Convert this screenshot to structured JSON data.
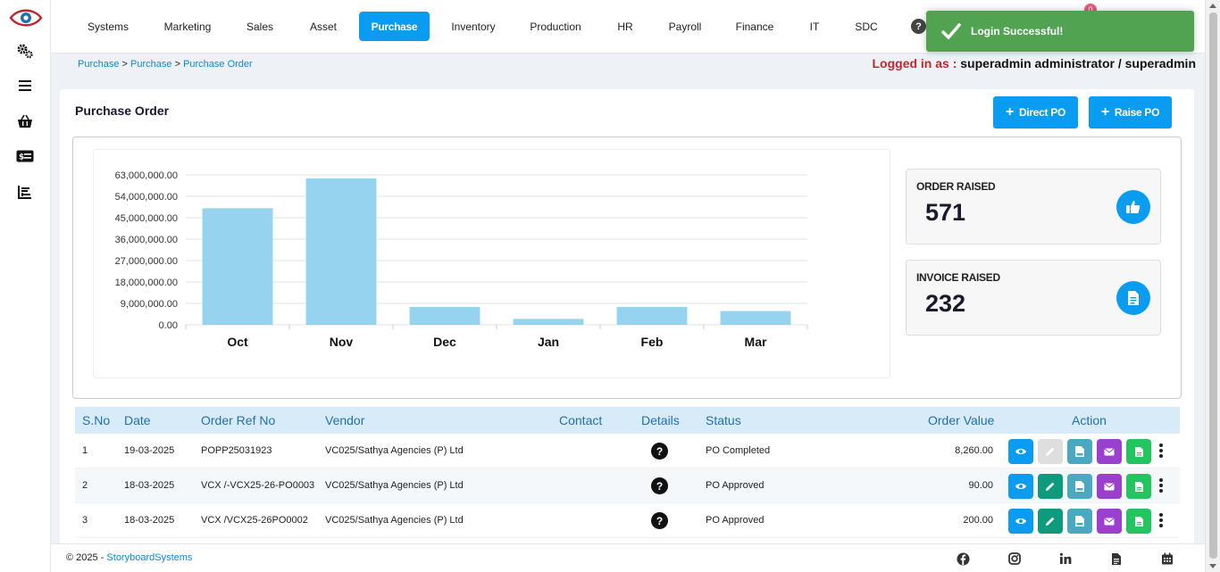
{
  "nav": {
    "tabs": [
      "Systems",
      "Marketing",
      "Sales",
      "Asset",
      "Purchase",
      "Inventory",
      "Production",
      "HR",
      "Payroll",
      "Finance",
      "IT",
      "SDC"
    ],
    "active_tab": "Purchase",
    "help_icon": "?",
    "notification_count": "0"
  },
  "toast": {
    "message": "Login Successful!",
    "color": "#51a351"
  },
  "breadcrumb": {
    "items": [
      "Purchase",
      "Purchase",
      "Purchase Order"
    ],
    "sep": " > "
  },
  "user": {
    "label": "Logged in as :",
    "name": "superadmin administrator / superadmin"
  },
  "page": {
    "title": "Purchase Order",
    "direct_po_label": "Direct PO",
    "raise_po_label": "Raise PO"
  },
  "chart_data": {
    "type": "bar",
    "categories": [
      "Oct",
      "Nov",
      "Dec",
      "Jan",
      "Feb",
      "Mar"
    ],
    "values": [
      49000000,
      61500000,
      7500000,
      2500000,
      7500000,
      5800000
    ],
    "ylim": [
      0,
      63000000
    ],
    "yticks": [
      "0.00",
      "9,000,000.00",
      "18,000,000.00",
      "27,000,000.00",
      "36,000,000.00",
      "45,000,000.00",
      "54,000,000.00",
      "63,000,000.00"
    ],
    "grid": true,
    "bar_color": "#96d3ee"
  },
  "stats": {
    "order_raised": {
      "label": "ORDER RAISED",
      "value": "571",
      "icon": "thumbs-up-icon"
    },
    "invoice_raised": {
      "label": "INVOICE RAISED",
      "value": "232",
      "icon": "document-icon"
    }
  },
  "table": {
    "headers": {
      "sno": "S.No",
      "date": "Date",
      "ref": "Order Ref No",
      "vendor": "Vendor",
      "contact": "Contact",
      "details": "Details",
      "status": "Status",
      "value": "Order Value",
      "action": "Action"
    },
    "rows": [
      {
        "sno": "1",
        "date": "19-03-2025",
        "ref": "POPP25031923",
        "vendor": "VC025/Sathya Agencies (P) Ltd",
        "contact": "",
        "status": "PO Completed",
        "value": "8,260.00",
        "edit_enabled": false
      },
      {
        "sno": "2",
        "date": "18-03-2025",
        "ref": "VCX /-VCX25-26-PO0003",
        "vendor": "VC025/Sathya Agencies (P) Ltd",
        "contact": "",
        "status": "PO Approved",
        "value": "90.00",
        "edit_enabled": true
      },
      {
        "sno": "3",
        "date": "18-03-2025",
        "ref": "VCX /VCX25-26PO0002",
        "vendor": "VC025/Sathya Agencies (P) Ltd",
        "contact": "",
        "status": "PO Approved",
        "value": "200.00",
        "edit_enabled": true
      }
    ],
    "details_icon": "?"
  },
  "footer": {
    "copyright": "© 2025 - ",
    "company": "StoryboardSystems"
  },
  "colors": {
    "accent": "#0a9cf0",
    "view": "#0a9cf0",
    "edit": "#0e9a7c",
    "edit_disabled": "#dedede",
    "pdf": "#4aa8c0",
    "mail": "#9b3fce",
    "doc": "#22c55e"
  }
}
